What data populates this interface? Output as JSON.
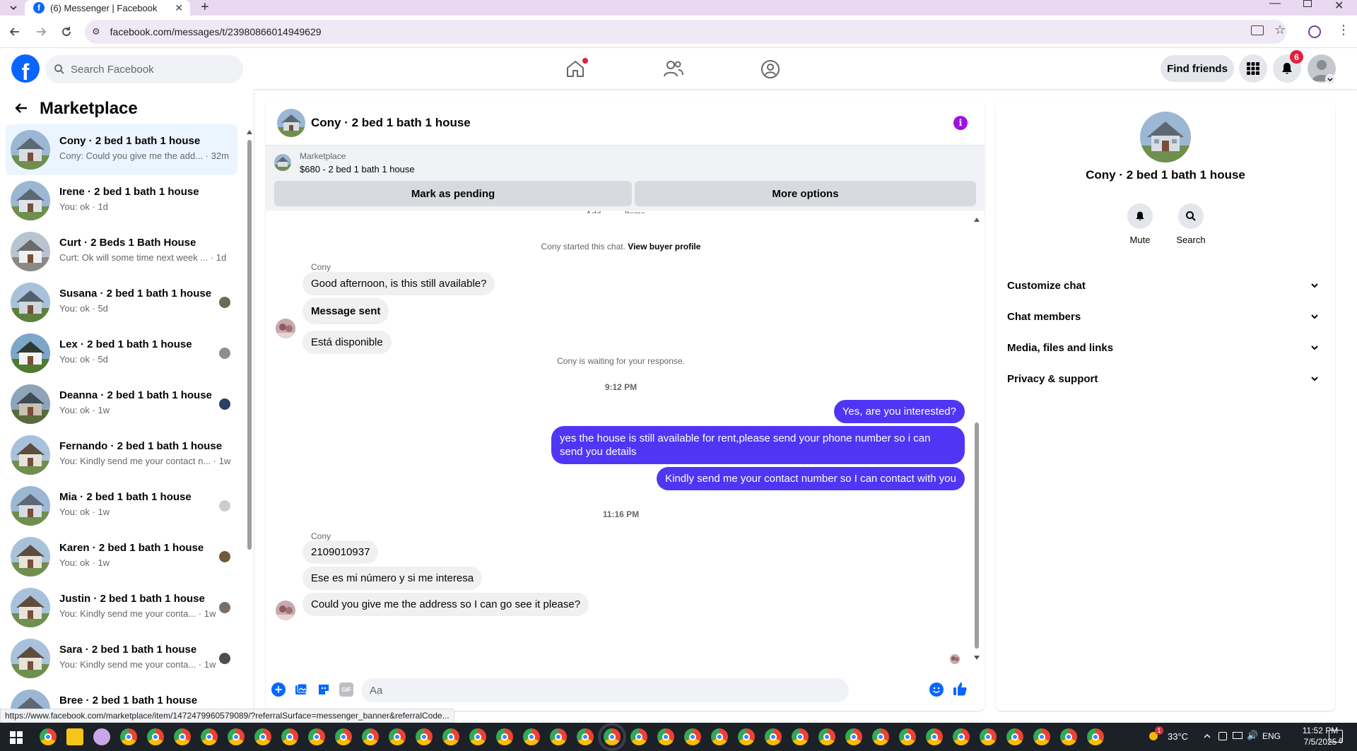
{
  "browser": {
    "tab_title": "(6) Messenger | Facebook",
    "url": "facebook.com/messages/t/23980866014949629",
    "status_url": "https://www.facebook.com/marketplace/item/1472479960579089/?referralSurface=messenger_banner&referralCode..."
  },
  "fbnav": {
    "search_placeholder": "Search Facebook",
    "find_friends": "Find friends",
    "notification_count": "6",
    "accent": "#0866ff"
  },
  "sidebar": {
    "title": "Marketplace",
    "conversations": [
      {
        "title": "Cony · 2 bed 1 bath 1 house",
        "sub": "Cony: Could you give me the add... · 32m"
      },
      {
        "title": "Irene · 2 bed 1 bath 1 house",
        "sub": "You: ok · 1d"
      },
      {
        "title": "Curt · 2 Beds 1 Bath House",
        "sub": "Curt: Ok will some time next week ... · 1d"
      },
      {
        "title": "Susana · 2 bed 1 bath 1 house",
        "sub": "You: ok · 5d"
      },
      {
        "title": "Lex · 2 bed 1 bath 1 house",
        "sub": "You: ok · 5d"
      },
      {
        "title": "Deanna · 2 bed 1 bath 1 house",
        "sub": "You: ok · 1w"
      },
      {
        "title": "Fernando · 2 bed 1 bath 1 house",
        "sub": "You: Kindly send me your contact n... · 1w"
      },
      {
        "title": "Mia · 2 bed 1 bath 1 house",
        "sub": "You: ok · 1w"
      },
      {
        "title": "Karen · 2 bed 1 bath 1 house",
        "sub": "You: ok · 1w"
      },
      {
        "title": "Justin · 2 bed 1 bath 1 house",
        "sub": "You: Kindly send me your conta... · 1w"
      },
      {
        "title": "Sara · 2 bed 1 bath 1 house",
        "sub": "You: Kindly send me your conta... · 1w"
      },
      {
        "title": "Bree · 2 bed 1 bath 1 house",
        "sub": ""
      }
    ]
  },
  "chat": {
    "header_title": "Cony · 2 bed 1 bath 1 house",
    "banner_label": "Marketplace",
    "banner_item": "$680 - 2 bed 1 bath 1 house",
    "mark_pending": "Mark as pending",
    "more_options": "More options",
    "cropped_top_text": "Add          Items",
    "started_text": "Cony started this chat.",
    "view_profile": "View buyer profile",
    "sender_name_1": "Cony",
    "msg_1": "Good afternoon, is this still available?",
    "msg_2": "Message sent",
    "msg_3": "Está disponible",
    "waiting": "Cony is waiting for your response.",
    "time_1": "9:12 PM",
    "out_1": "Yes, are you interested?",
    "out_2": "yes the house is still available for rent,please send your  phone number so i can send you details",
    "out_3": "Kindly send me your contact number so I can contact with you",
    "time_2": "11:16 PM",
    "sender_name_2": "Cony",
    "msg_4": "2109010937",
    "msg_5": "Ese es mi número y si me interesa",
    "msg_6": "Could you give me the address so I can go see it please?",
    "composer_placeholder": "Aa",
    "out_color": "#5135f5"
  },
  "rightpanel": {
    "title": "Cony · 2 bed 1 bath 1 house",
    "mute": "Mute",
    "search": "Search",
    "sections": [
      "Customize chat",
      "Chat members",
      "Media, files and links",
      "Privacy & support"
    ]
  },
  "taskbar": {
    "temperature": "33°C",
    "language": "ENG",
    "time": "11:52 PM",
    "date": "7/5/2025",
    "notif": "6",
    "weather_badge": "1"
  }
}
